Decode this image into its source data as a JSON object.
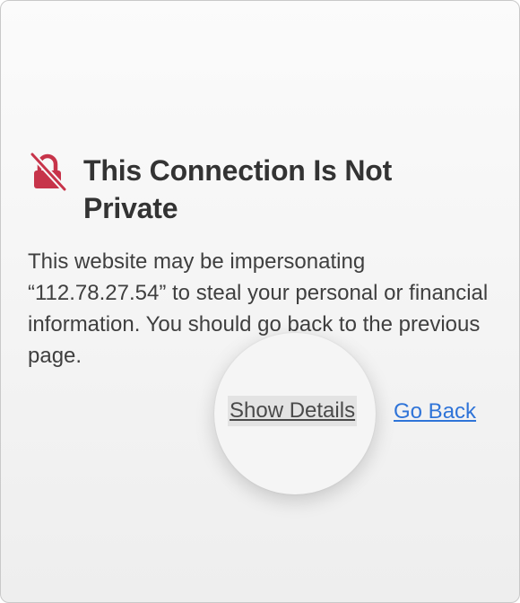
{
  "warning": {
    "icon": "crossed-lock-icon",
    "accent_color": "#c7344a",
    "title": "This Connection Is Not Private",
    "message": "This website may be impersonating “112.78.27.54” to steal your personal or financial information. You should go back to the previous page."
  },
  "actions": {
    "show_details_label": "Show Details",
    "go_back_label": "Go Back",
    "link_color": "#2f74d8"
  }
}
